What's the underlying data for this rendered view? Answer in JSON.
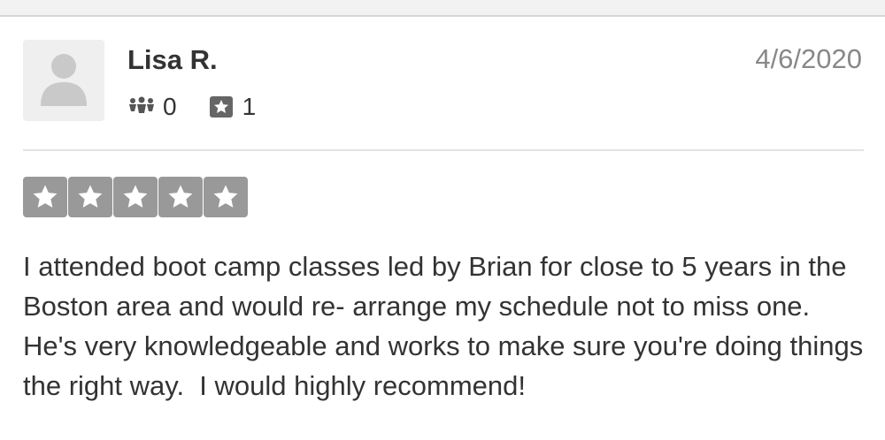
{
  "review": {
    "reviewer_name": "Lisa R.",
    "date": "4/6/2020",
    "friends_count": "0",
    "reviews_count": "1",
    "rating": 5,
    "rating_max": 5,
    "text": "I attended boot camp classes led by Brian for close to 5 years in the Boston area and would re- arrange my schedule not to miss one.  He's very knowledgeable and works to make sure you're doing things the right way.  I would highly recommend!"
  },
  "icons": {
    "avatar": "default-user-avatar-icon",
    "friends": "friends-icon",
    "reviews": "review-star-icon",
    "rating_star": "star-icon"
  },
  "colors": {
    "star_box": "#999999",
    "name_text": "#333333",
    "date_text": "#888888",
    "avatar_bg": "#efefef"
  }
}
